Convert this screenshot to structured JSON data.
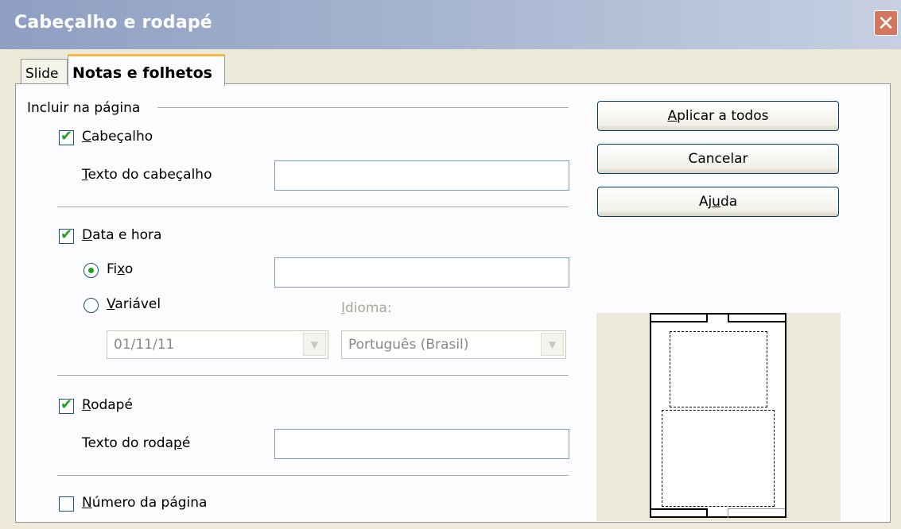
{
  "window": {
    "title": "Cabeçalho e rodapé",
    "close_icon": "close-icon"
  },
  "tabs": [
    {
      "label": "Slide",
      "active": false
    },
    {
      "label": "Notas e folhetos",
      "active": true
    }
  ],
  "section": {
    "label": "Incluir na página"
  },
  "header": {
    "checkbox_label_u": "C",
    "checkbox_label_rest": "abeçalho",
    "checked": true,
    "text_label_u": "T",
    "text_label_rest": "exto do cabeçalho",
    "text_value": ""
  },
  "datetime": {
    "checkbox_label_u": "D",
    "checkbox_label_rest": "ata e hora",
    "checked": true,
    "fixed_label_pre": "Fi",
    "fixed_label_u": "x",
    "fixed_label_post": "o",
    "fixed_selected": true,
    "fixed_value": "",
    "variable_label_u": "V",
    "variable_label_rest": "ariável",
    "variable_selected": false,
    "format_value": "01/11/11",
    "language_label_u": "I",
    "language_label_rest": "dioma:",
    "language_value": "Português (Brasil)"
  },
  "footer": {
    "checkbox_label_u": "R",
    "checkbox_label_rest": "odapé",
    "checked": true,
    "text_label_pre": "Texto do roda",
    "text_label_u": "p",
    "text_label_post": "é",
    "text_value": ""
  },
  "page_number": {
    "checkbox_label_u": "N",
    "checkbox_label_rest": "úmero da página",
    "checked": false
  },
  "buttons": {
    "apply_all_u": "A",
    "apply_all_rest": "plicar a todos",
    "cancel": "Cancelar",
    "help_pre": "Aj",
    "help_u": "u",
    "help_post": "da"
  },
  "colors": {
    "check_mark": "#21A121",
    "tab_highlight": "#F9B74A",
    "dialog_bg": "#ECE9D8"
  }
}
